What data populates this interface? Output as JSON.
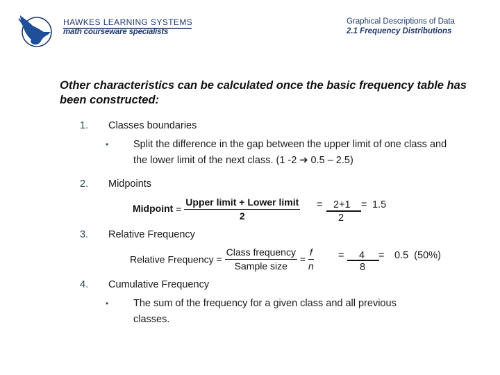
{
  "header": {
    "brand_name": "HAWKES LEARNING SYSTEMS",
    "brand_tagline": "math courseware specialists",
    "chapter_title": "Graphical Descriptions of Data",
    "section_title": "2.1 Frequency Distributions",
    "logo_icon": "hawk-in-circle-icon",
    "brand_color": "#1f3a6b"
  },
  "intro": "Other characteristics can be calculated once the basic frequency table has been constructed:",
  "items": [
    {
      "number": "1.",
      "label": "Classes boundaries",
      "bullet": "•",
      "bullet_text": "Split the difference in the gap between the upper limit of one class and the lower limit of the next class. (1 -2 ➔ 0.5 – 2.5)"
    },
    {
      "number": "2.",
      "label": "Midpoints",
      "formula": {
        "lhs": "Midpoint",
        "eq": "=",
        "numerator": "Upper limit + Lower limit",
        "denominator": "2"
      },
      "example": {
        "eq1": "=",
        "numerator": "2+1",
        "denominator": "2",
        "eq2": "=",
        "result": "1.5"
      }
    },
    {
      "number": "3.",
      "label": "Relative Frequency",
      "formula": {
        "lhs": "Relative Frequency",
        "eq": "=",
        "numerator": "Class frequency",
        "denominator": "Sample size",
        "eq2": "=",
        "numerator2": "f",
        "denominator2": "n"
      },
      "example": {
        "eq1": "=",
        "numerator": "4",
        "denominator": "8",
        "eq2": "=",
        "result": "0.5  (50%)"
      }
    },
    {
      "number": "4.",
      "label": "Cumulative Frequency",
      "bullet": "•",
      "bullet_text": "The sum of the frequency for a given class and all previous classes."
    }
  ]
}
